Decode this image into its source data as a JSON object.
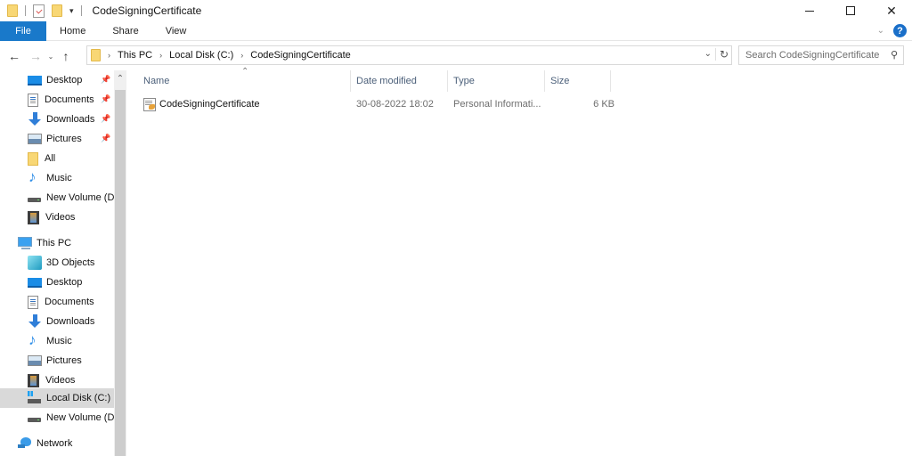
{
  "window": {
    "title": "CodeSigningCertificate",
    "controls": {
      "minimize": "minimize",
      "maximize": "maximize",
      "close": "✕"
    }
  },
  "ribbon": {
    "tabs": [
      {
        "label": "File"
      },
      {
        "label": "Home"
      },
      {
        "label": "Share"
      },
      {
        "label": "View"
      }
    ]
  },
  "navigation": {
    "back": "←",
    "forward": "→",
    "recent": "⌄",
    "up": "↑",
    "breadcrumb": [
      "This PC",
      "Local Disk (C:)",
      "CodeSigningCertificate"
    ],
    "search_placeholder": "Search CodeSigningCertificate"
  },
  "sidebar": {
    "quick_access": [
      {
        "label": "Desktop",
        "icon": "desktop-icon",
        "pinned": true
      },
      {
        "label": "Documents",
        "icon": "documents-icon",
        "pinned": true
      },
      {
        "label": "Downloads",
        "icon": "downloads-icon",
        "pinned": true
      },
      {
        "label": "Pictures",
        "icon": "pictures-icon",
        "pinned": true
      },
      {
        "label": "All",
        "icon": "folder-icon",
        "pinned": false
      },
      {
        "label": "Music",
        "icon": "music-icon",
        "pinned": false
      },
      {
        "label": "New Volume (D:)",
        "icon": "drive-icon",
        "pinned": false
      },
      {
        "label": "Videos",
        "icon": "videos-icon",
        "pinned": false
      }
    ],
    "this_pc": {
      "label": "This PC",
      "items": [
        {
          "label": "3D Objects",
          "icon": "3d-objects-icon"
        },
        {
          "label": "Desktop",
          "icon": "desktop-icon"
        },
        {
          "label": "Documents",
          "icon": "documents-icon"
        },
        {
          "label": "Downloads",
          "icon": "downloads-icon"
        },
        {
          "label": "Music",
          "icon": "music-icon"
        },
        {
          "label": "Pictures",
          "icon": "pictures-icon"
        },
        {
          "label": "Videos",
          "icon": "videos-icon"
        },
        {
          "label": "Local Disk (C:)",
          "icon": "local-disk-icon",
          "selected": true
        },
        {
          "label": "New Volume (D:)",
          "icon": "drive-icon"
        }
      ]
    },
    "network": {
      "label": "Network"
    }
  },
  "file_list": {
    "columns": {
      "name": "Name",
      "date": "Date modified",
      "type": "Type",
      "size": "Size"
    },
    "sorted_by": "Name",
    "files": [
      {
        "name": "CodeSigningCertificate",
        "date": "30-08-2022 18:02",
        "type": "Personal Informati...",
        "size": "6 KB",
        "icon": "certificate-file-icon"
      }
    ]
  }
}
